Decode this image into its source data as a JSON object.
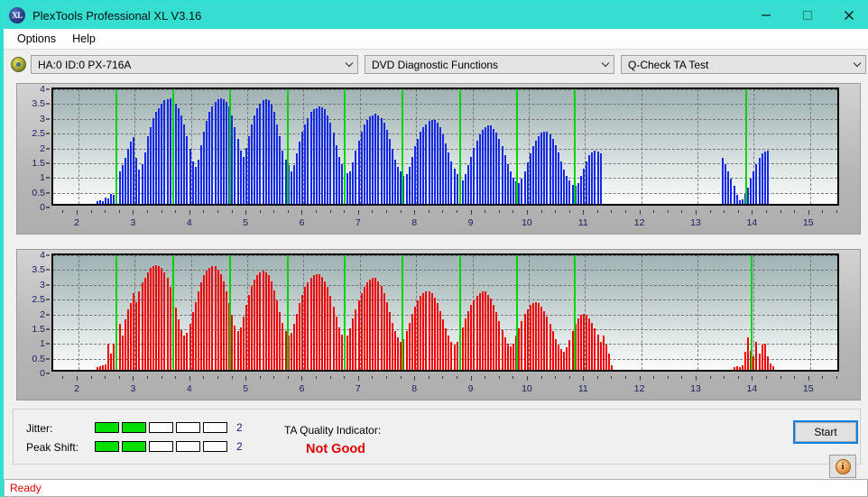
{
  "window": {
    "title": "PlexTools Professional XL V3.16",
    "app_icon": "xl-logo-icon",
    "minimize": "minimize-icon",
    "maximize": "maximize-icon",
    "close": "close-icon"
  },
  "menubar": {
    "items": [
      {
        "label": "Options"
      },
      {
        "label": "Help"
      }
    ]
  },
  "toolbar": {
    "drive_icon": "disc-drive-icon",
    "drive_combo": {
      "value": "HA:0 ID:0  PX-716A",
      "arrow": "chevron-down-icon"
    },
    "function_combo": {
      "value": "DVD Diagnostic Functions",
      "arrow": "chevron-down-icon"
    },
    "test_combo": {
      "value": "Q-Check TA Test",
      "arrow": "chevron-down-icon"
    }
  },
  "status_panel": {
    "jitter_label": "Jitter:",
    "jitter_value": "2",
    "jitter_segments_total": 5,
    "jitter_segments_filled": 2,
    "peak_shift_label": "Peak Shift:",
    "peak_shift_value": "2",
    "peak_shift_segments_total": 5,
    "peak_shift_segments_filled": 2,
    "ta_quality_label": "TA Quality Indicator:",
    "ta_quality_value": "Not Good",
    "ta_quality_color": "#e00000",
    "meter_on_color": "#00e000",
    "start_button": "Start",
    "info_button": "info-icon"
  },
  "statusbar": {
    "text": "Ready",
    "color": "#e00000"
  },
  "chart_data": [
    {
      "id": "top",
      "type": "bar",
      "title": "",
      "series_name": "Jitter",
      "color": "#1628e8",
      "xlabel": "",
      "ylabel": "",
      "xlim": [
        1.55,
        15.55
      ],
      "ylim": [
        0,
        4
      ],
      "yticks": [
        0,
        0.5,
        1,
        1.5,
        2,
        2.5,
        3,
        3.5,
        4
      ],
      "xticks": [
        2,
        3,
        4,
        5,
        6,
        7,
        8,
        9,
        10,
        11,
        12,
        13,
        14,
        15
      ],
      "grid": true,
      "markers": [
        2.65,
        3.67,
        4.68,
        5.7,
        6.72,
        7.74,
        8.76,
        9.78,
        10.8,
        13.85
      ],
      "x": [
        2.33,
        2.38,
        2.43,
        2.48,
        2.53,
        2.58,
        2.63,
        2.68,
        2.73,
        2.78,
        2.83,
        2.88,
        2.93,
        2.98,
        3.03,
        3.08,
        3.13,
        3.18,
        3.23,
        3.28,
        3.33,
        3.38,
        3.43,
        3.48,
        3.53,
        3.58,
        3.63,
        3.68,
        3.73,
        3.78,
        3.83,
        3.88,
        3.93,
        3.98,
        4.03,
        4.08,
        4.13,
        4.18,
        4.23,
        4.28,
        4.33,
        4.38,
        4.43,
        4.48,
        4.53,
        4.58,
        4.63,
        4.68,
        4.73,
        4.78,
        4.83,
        4.88,
        4.93,
        4.98,
        5.03,
        5.08,
        5.13,
        5.18,
        5.23,
        5.28,
        5.33,
        5.38,
        5.43,
        5.48,
        5.53,
        5.58,
        5.63,
        5.68,
        5.73,
        5.78,
        5.83,
        5.88,
        5.93,
        5.98,
        6.03,
        6.08,
        6.13,
        6.18,
        6.23,
        6.28,
        6.33,
        6.38,
        6.43,
        6.48,
        6.53,
        6.58,
        6.63,
        6.68,
        6.73,
        6.78,
        6.83,
        6.88,
        6.93,
        6.98,
        7.03,
        7.08,
        7.13,
        7.18,
        7.23,
        7.28,
        7.33,
        7.38,
        7.43,
        7.48,
        7.53,
        7.58,
        7.63,
        7.68,
        7.73,
        7.78,
        7.83,
        7.88,
        7.93,
        7.98,
        8.03,
        8.08,
        8.13,
        8.18,
        8.23,
        8.28,
        8.33,
        8.38,
        8.43,
        8.48,
        8.53,
        8.58,
        8.63,
        8.68,
        8.73,
        8.78,
        8.83,
        8.88,
        8.93,
        8.98,
        9.03,
        9.08,
        9.13,
        9.18,
        9.23,
        9.28,
        9.33,
        9.38,
        9.43,
        9.48,
        9.53,
        9.58,
        9.63,
        9.68,
        9.73,
        9.78,
        9.83,
        9.88,
        9.93,
        9.98,
        10.03,
        10.08,
        10.13,
        10.18,
        10.23,
        10.28,
        10.33,
        10.38,
        10.43,
        10.48,
        10.53,
        10.58,
        10.63,
        10.68,
        10.73,
        10.78,
        10.83,
        10.88,
        10.93,
        10.98,
        11.03,
        11.08,
        11.13,
        11.18,
        11.23,
        11.28,
        13.45,
        13.5,
        13.55,
        13.6,
        13.65,
        13.7,
        13.75,
        13.8,
        13.85,
        13.9,
        13.95,
        14.0,
        14.05,
        14.1,
        14.15,
        14.2,
        14.25
      ],
      "values": [
        0.08,
        0.12,
        0.1,
        0.22,
        0.18,
        0.35,
        0.3,
        1.15,
        1.1,
        1.3,
        1.55,
        1.85,
        2.1,
        2.25,
        1.55,
        1.15,
        1.35,
        1.75,
        2.3,
        2.6,
        2.9,
        3.1,
        3.25,
        3.4,
        3.5,
        3.55,
        3.56,
        3.5,
        3.4,
        3.25,
        3.0,
        2.7,
        2.3,
        1.85,
        1.45,
        1.25,
        1.5,
        2.0,
        2.45,
        2.8,
        3.1,
        3.3,
        3.45,
        3.55,
        3.58,
        3.55,
        3.45,
        3.3,
        3.0,
        2.6,
        2.2,
        1.8,
        1.6,
        1.9,
        2.3,
        2.7,
        3.0,
        3.25,
        3.4,
        3.5,
        3.55,
        3.5,
        3.35,
        3.1,
        2.7,
        2.3,
        1.8,
        1.5,
        1.3,
        1.1,
        1.3,
        1.7,
        2.1,
        2.45,
        2.7,
        2.9,
        3.1,
        3.2,
        3.25,
        3.3,
        3.28,
        3.2,
        3.0,
        2.75,
        2.4,
        2.0,
        1.6,
        1.35,
        1.2,
        1.05,
        1.1,
        1.4,
        1.8,
        2.15,
        2.45,
        2.7,
        2.85,
        2.95,
        3.0,
        3.05,
        3.0,
        2.9,
        2.75,
        2.5,
        2.2,
        1.85,
        1.5,
        1.25,
        1.1,
        0.95,
        1.0,
        1.25,
        1.6,
        1.95,
        2.2,
        2.45,
        2.6,
        2.7,
        2.8,
        2.85,
        2.85,
        2.75,
        2.6,
        2.35,
        2.05,
        1.75,
        1.45,
        1.2,
        1.0,
        0.85,
        0.8,
        1.0,
        1.3,
        1.6,
        1.9,
        2.15,
        2.35,
        2.5,
        2.6,
        2.65,
        2.65,
        2.55,
        2.4,
        2.2,
        1.95,
        1.65,
        1.35,
        1.1,
        0.9,
        0.75,
        0.7,
        0.85,
        1.1,
        1.4,
        1.7,
        1.95,
        2.15,
        2.3,
        2.4,
        2.45,
        2.45,
        2.35,
        2.2,
        2.0,
        1.75,
        1.45,
        1.15,
        0.95,
        0.78,
        0.65,
        0.6,
        0.7,
        0.95,
        1.2,
        1.45,
        1.65,
        1.75,
        1.8,
        1.78,
        1.7,
        1.55,
        1.35,
        1.1,
        0.85,
        0.6,
        0.3,
        0.12,
        0.15,
        0.35,
        0.55,
        0.85,
        1.1,
        1.35,
        1.55,
        1.7,
        1.78,
        1.8,
        1.75,
        1.65,
        1.5,
        1.25,
        1.0,
        0.7,
        0.4,
        0.15
      ]
    },
    {
      "id": "bottom",
      "type": "bar",
      "title": "",
      "series_name": "Peak Shift",
      "color": "#f40000",
      "xlabel": "",
      "ylabel": "",
      "xlim": [
        1.55,
        15.55
      ],
      "ylim": [
        0,
        4
      ],
      "yticks": [
        0,
        0.5,
        1,
        1.5,
        2,
        2.5,
        3,
        3.5,
        4
      ],
      "xticks": [
        2,
        3,
        4,
        5,
        6,
        7,
        8,
        9,
        10,
        11,
        12,
        13,
        14,
        15
      ],
      "grid": true,
      "markers": [
        2.65,
        3.67,
        4.68,
        5.7,
        6.72,
        7.74,
        8.76,
        9.78,
        10.8,
        13.95
      ],
      "x": [
        2.33,
        2.38,
        2.43,
        2.48,
        2.53,
        2.58,
        2.63,
        2.68,
        2.73,
        2.78,
        2.83,
        2.88,
        2.93,
        2.98,
        3.03,
        3.08,
        3.13,
        3.18,
        3.23,
        3.28,
        3.33,
        3.38,
        3.43,
        3.48,
        3.53,
        3.58,
        3.63,
        3.68,
        3.73,
        3.78,
        3.83,
        3.88,
        3.93,
        3.98,
        4.03,
        4.08,
        4.13,
        4.18,
        4.23,
        4.28,
        4.33,
        4.38,
        4.43,
        4.48,
        4.53,
        4.58,
        4.63,
        4.68,
        4.73,
        4.78,
        4.83,
        4.88,
        4.93,
        4.98,
        5.03,
        5.08,
        5.13,
        5.18,
        5.23,
        5.28,
        5.33,
        5.38,
        5.43,
        5.48,
        5.53,
        5.58,
        5.63,
        5.68,
        5.73,
        5.78,
        5.83,
        5.88,
        5.93,
        5.98,
        6.03,
        6.08,
        6.13,
        6.18,
        6.23,
        6.28,
        6.33,
        6.38,
        6.43,
        6.48,
        6.53,
        6.58,
        6.63,
        6.68,
        6.73,
        6.78,
        6.83,
        6.88,
        6.93,
        6.98,
        7.03,
        7.08,
        7.13,
        7.18,
        7.23,
        7.28,
        7.33,
        7.38,
        7.43,
        7.48,
        7.53,
        7.58,
        7.63,
        7.68,
        7.73,
        7.78,
        7.83,
        7.88,
        7.93,
        7.98,
        8.03,
        8.08,
        8.13,
        8.18,
        8.23,
        8.28,
        8.33,
        8.38,
        8.43,
        8.48,
        8.53,
        8.58,
        8.63,
        8.68,
        8.73,
        8.78,
        8.83,
        8.88,
        8.93,
        8.98,
        9.03,
        9.08,
        9.13,
        9.18,
        9.23,
        9.28,
        9.33,
        9.38,
        9.43,
        9.48,
        9.53,
        9.58,
        9.63,
        9.68,
        9.73,
        9.78,
        9.83,
        9.88,
        9.93,
        9.98,
        10.03,
        10.08,
        10.13,
        10.18,
        10.23,
        10.28,
        10.33,
        10.38,
        10.43,
        10.48,
        10.53,
        10.58,
        10.63,
        10.68,
        10.73,
        10.78,
        10.83,
        10.88,
        10.93,
        10.98,
        11.03,
        11.08,
        11.13,
        11.18,
        11.23,
        11.28,
        11.33,
        11.38,
        11.43,
        11.48,
        13.65,
        13.7,
        13.75,
        13.8,
        13.85,
        13.9,
        13.95,
        14.0,
        14.05,
        14.1,
        14.15,
        14.2,
        14.25,
        14.3,
        14.35
      ],
      "values": [
        0.1,
        0.12,
        0.15,
        0.18,
        0.9,
        0.55,
        0.9,
        1.1,
        1.55,
        1.15,
        1.7,
        2.05,
        2.25,
        2.6,
        2.3,
        2.65,
        2.95,
        3.1,
        3.3,
        3.45,
        3.52,
        3.55,
        3.5,
        3.45,
        3.3,
        3.1,
        2.8,
        2.45,
        2.1,
        1.7,
        1.35,
        1.15,
        1.25,
        1.55,
        1.95,
        2.3,
        2.65,
        2.95,
        3.2,
        3.35,
        3.45,
        3.52,
        3.5,
        3.4,
        3.25,
        3.0,
        2.65,
        2.25,
        1.85,
        1.5,
        1.3,
        1.45,
        1.8,
        2.2,
        2.55,
        2.85,
        3.05,
        3.2,
        3.3,
        3.35,
        3.3,
        3.2,
        3.0,
        2.7,
        2.35,
        1.95,
        1.6,
        1.3,
        1.15,
        1.25,
        1.55,
        1.9,
        2.25,
        2.55,
        2.8,
        2.95,
        3.1,
        3.2,
        3.25,
        3.25,
        3.15,
        3.0,
        2.8,
        2.5,
        2.15,
        1.8,
        1.45,
        1.2,
        1.05,
        1.15,
        1.4,
        1.75,
        2.05,
        2.35,
        2.6,
        2.8,
        2.95,
        3.05,
        3.1,
        3.1,
        3.0,
        2.85,
        2.6,
        2.3,
        1.95,
        1.6,
        1.3,
        1.1,
        0.95,
        1.05,
        1.3,
        1.6,
        1.9,
        2.15,
        2.35,
        2.5,
        2.6,
        2.65,
        2.65,
        2.6,
        2.45,
        2.25,
        2.0,
        1.7,
        1.4,
        1.15,
        0.95,
        0.85,
        0.95,
        1.2,
        1.45,
        1.75,
        2.0,
        2.2,
        2.35,
        2.5,
        2.6,
        2.65,
        2.65,
        2.55,
        2.4,
        2.2,
        1.95,
        1.65,
        1.35,
        1.1,
        0.9,
        0.8,
        0.9,
        1.15,
        1.4,
        1.65,
        1.9,
        2.05,
        2.2,
        2.25,
        2.3,
        2.25,
        2.15,
        2.0,
        1.8,
        1.55,
        1.3,
        1.05,
        0.85,
        0.7,
        0.6,
        0.75,
        1.0,
        1.3,
        1.55,
        1.75,
        1.85,
        1.9,
        1.85,
        1.75,
        1.6,
        1.4,
        1.2,
        0.95,
        1.15,
        0.85,
        0.55,
        0.15,
        0.1,
        0.12,
        0.1,
        0.15,
        0.6,
        1.1,
        0.65,
        0.45,
        0.95,
        0.55,
        0.85,
        0.9,
        0.45,
        0.2,
        0.12
      ]
    }
  ]
}
